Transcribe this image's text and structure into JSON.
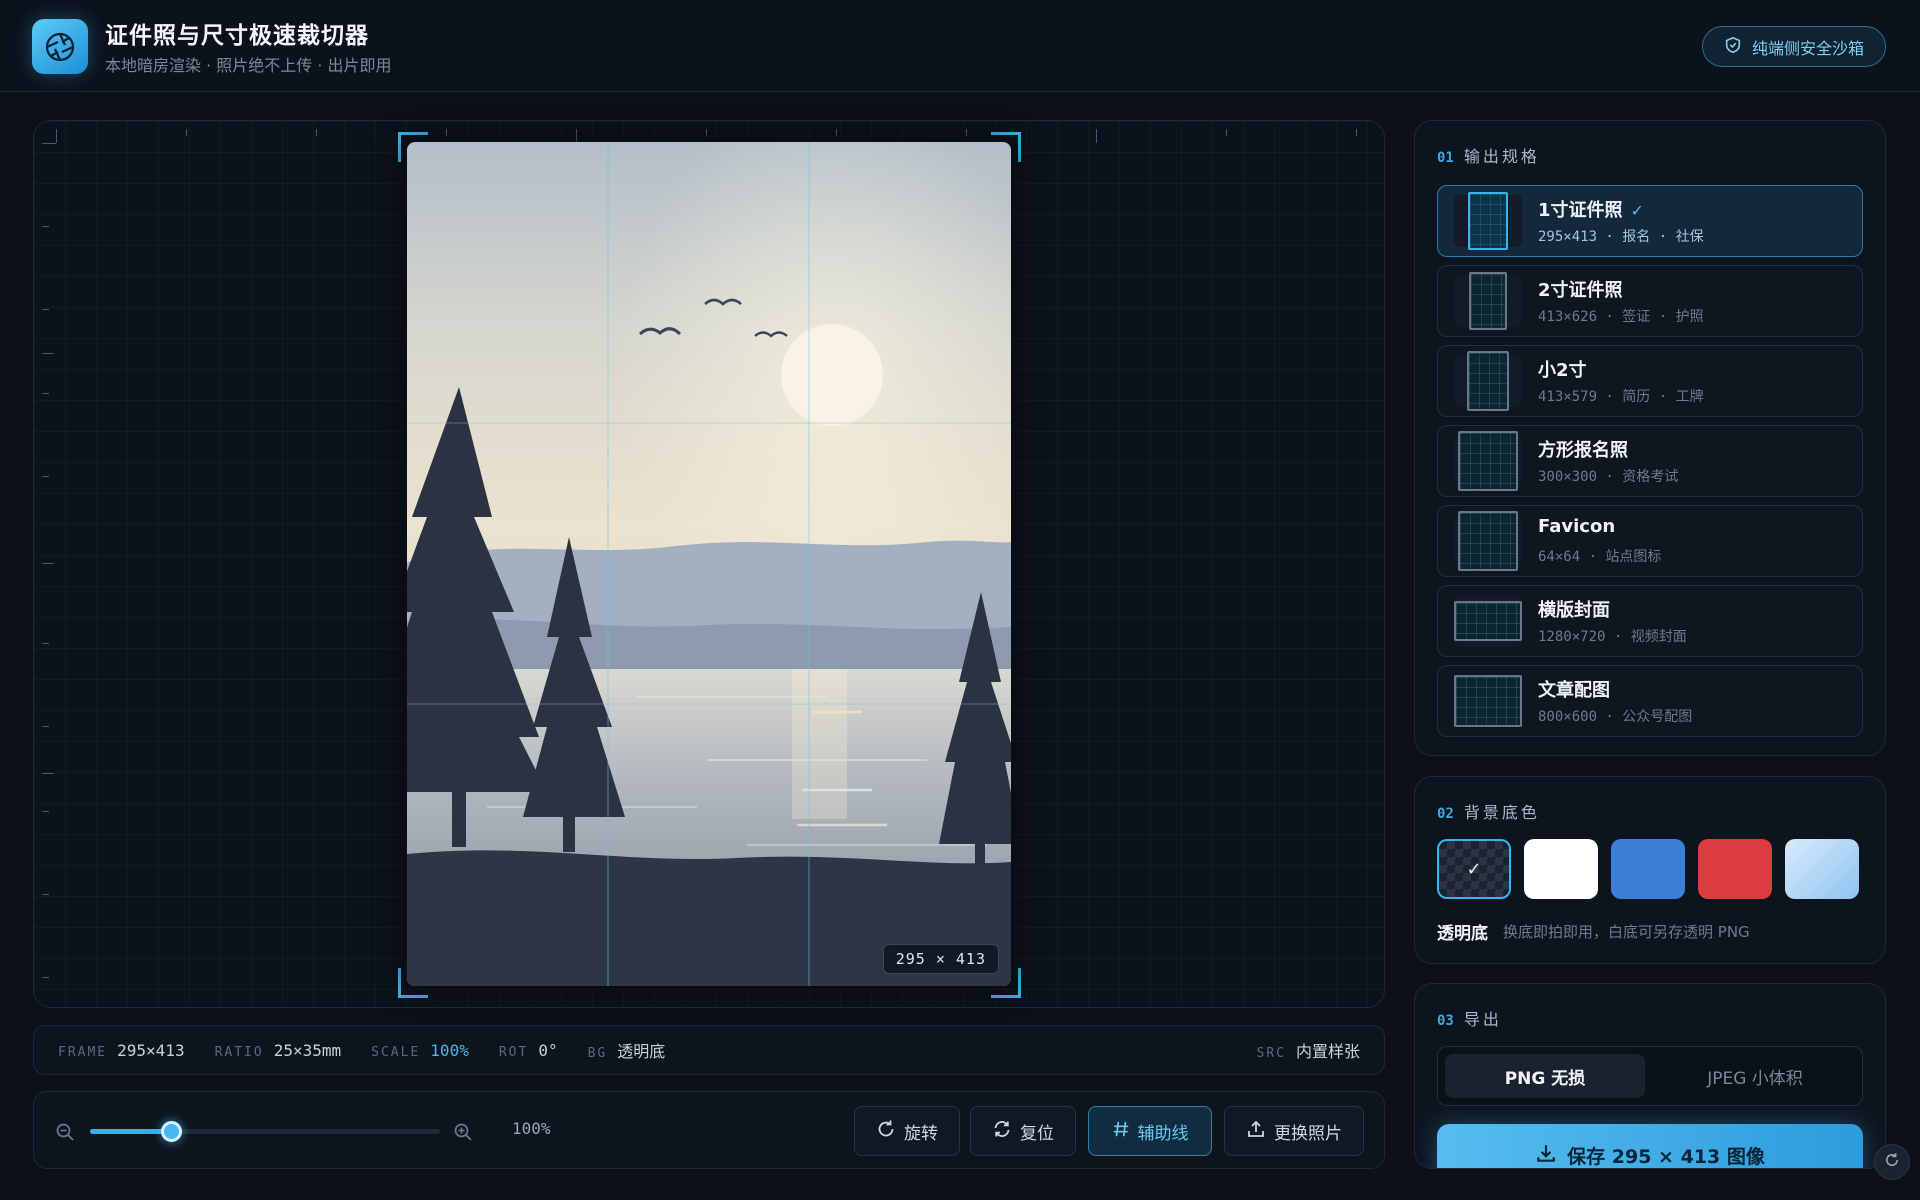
{
  "header": {
    "title": "证件照与尺寸极速裁切器",
    "subtitle": "本地暗房渲染 · 照片绝不上传 · 出片即用",
    "sandbox_label": "纯端侧安全沙箱"
  },
  "canvas": {
    "size_badge": "295 × 413"
  },
  "status": {
    "frame_key": "FRAME",
    "frame_val": "295×413",
    "ratio_key": "RATIO",
    "ratio_val": "25×35mm",
    "scale_key": "SCALE",
    "scale_val": "100%",
    "rot_key": "ROT",
    "rot_val": "0°",
    "bg_key": "BG",
    "bg_val": "透明底",
    "src_key": "SRC",
    "src_val": "内置样张"
  },
  "toolbar": {
    "zoom_label": "100%",
    "zoom_fraction": 0.23,
    "rotate_label": "旋转",
    "reset_label": "复位",
    "guides_label": "辅助线",
    "replace_label": "更换照片"
  },
  "specs_panel": {
    "num": "01",
    "title": "输出规格",
    "items": [
      {
        "name": "1寸证件照",
        "desc": "295×413 · 报名 · 社保",
        "check": "✓"
      },
      {
        "name": "2寸证件照",
        "desc": "413×626 · 签证 · 护照"
      },
      {
        "name": "小2寸",
        "desc": "413×579 · 简历 · 工牌"
      },
      {
        "name": "方形报名照",
        "desc": "300×300 · 资格考试"
      },
      {
        "name": "Favicon",
        "desc": "64×64 · 站点图标"
      },
      {
        "name": "横版封面",
        "desc": "1280×720 · 视频封面"
      },
      {
        "name": "文章配图",
        "desc": "800×600 · 公众号配图"
      }
    ]
  },
  "background_panel": {
    "num": "02",
    "title": "背景底色",
    "selected_label": "透明底",
    "hint": "换底即拍即用，白底可另存透明 PNG",
    "swatch_colors": [
      "transparent",
      "#ffffff",
      "#3c7fd9",
      "#dc3b3f",
      "#a9d2f5"
    ],
    "check": "✓"
  },
  "export_panel": {
    "num": "03",
    "title": "导出",
    "png_label": "PNG 无损",
    "jpeg_label": "JPEG 小体积",
    "save_label": "保存 295 × 413 图像"
  },
  "colors": {
    "accent": "#3ab3ee",
    "background": "#0b1019"
  }
}
